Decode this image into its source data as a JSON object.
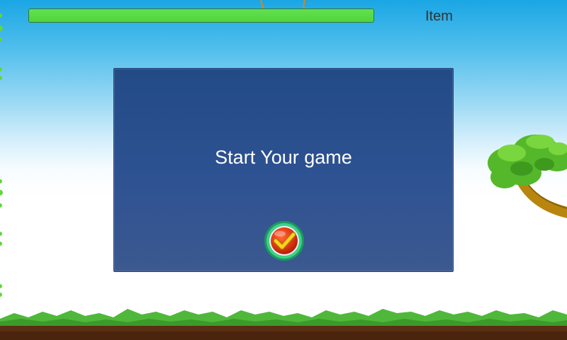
{
  "hud": {
    "health": {
      "fraction": 1.0,
      "color": "#55d843"
    },
    "item_label": "Item"
  },
  "dialog": {
    "title": "Start Your game",
    "background_color": "#2e5292",
    "confirm_icon": "checkmark-icon"
  },
  "scenery": {
    "sky_color": "#1aa6e4",
    "grass_color": "#4fb83a",
    "soil_color": "#5a2e12",
    "elements": [
      "palm-tree",
      "ground",
      "vines",
      "top-sprite"
    ]
  }
}
